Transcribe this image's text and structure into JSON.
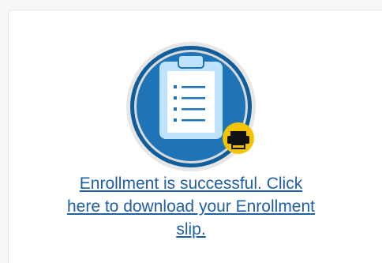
{
  "enrollment": {
    "icon": "clipboard-list-icon",
    "badge_icon": "printer-icon",
    "message_line1": "Enrollment is successful. Click",
    "message_line2": "here to download your Enrollment",
    "message_line3": "slip."
  },
  "colors": {
    "circle_outer": "#d9d9d9",
    "circle_ring": "#0f5d9a",
    "circle_inner": "#1f73b7",
    "clipboard_board": "#bfe3ff",
    "clipboard_paper": "#ffffff",
    "badge": "#f5c400",
    "link": "#1f5fa8"
  }
}
